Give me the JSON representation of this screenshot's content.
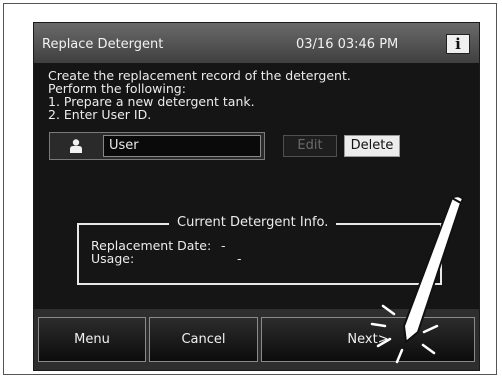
{
  "titlebar": {
    "title": "Replace Detergent",
    "datetime": "03/16 03:46 PM",
    "info_icon_glyph": "i",
    "info_icon": "info-icon"
  },
  "instructions": {
    "line1": "Create the replacement record of the detergent.",
    "line2": "Perform the following:",
    "line3": "1. Prepare a new detergent tank.",
    "line4": "2. Enter User ID."
  },
  "user": {
    "icon": "person-icon",
    "value": "User",
    "edit_label": "Edit",
    "delete_label": "Delete",
    "edit_enabled": false
  },
  "detergent_info": {
    "title": "Current Detergent Info.",
    "replacement_date_label": "Replacement Date:",
    "replacement_date_value": "-",
    "usage_label": "Usage:",
    "usage_value": "-"
  },
  "bottom": {
    "menu_label": "Menu",
    "cancel_label": "Cancel",
    "next_label": "Next>"
  },
  "overlay": {
    "stylus": "stylus-icon",
    "tap_indicator": "tap-burst-icon"
  },
  "colors": {
    "screen_bg": "#151515",
    "titlebar": "#5a5a5a",
    "text": "#ececec",
    "button_disabled_text": "#6a6a6a"
  }
}
